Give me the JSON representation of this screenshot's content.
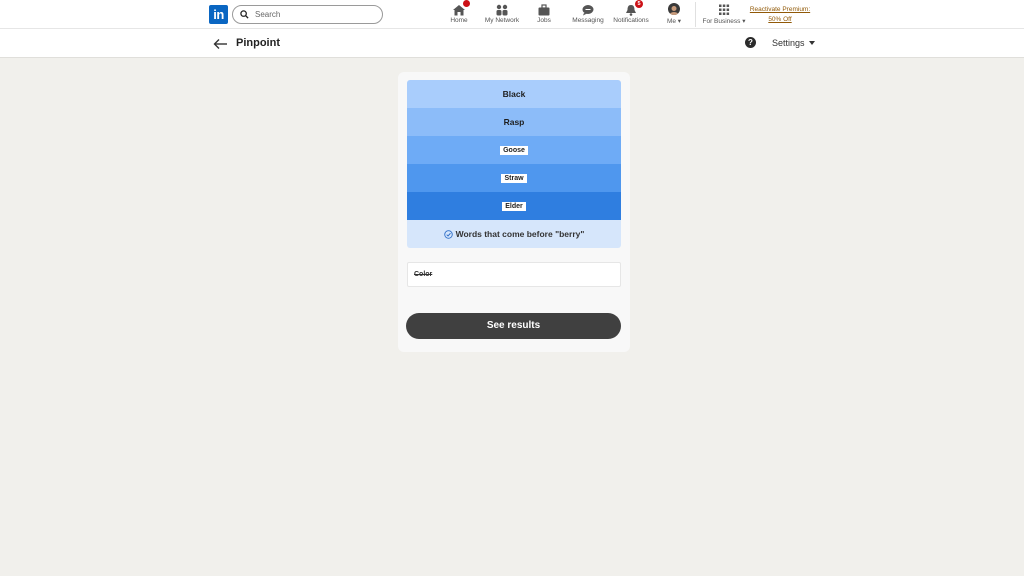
{
  "topnav": {
    "logo_text": "in",
    "search_placeholder": "Search",
    "items": [
      {
        "label": "Home",
        "icon": "home-icon",
        "badge": ""
      },
      {
        "label": "My Network",
        "icon": "network-icon",
        "badge": ""
      },
      {
        "label": "Jobs",
        "icon": "briefcase-icon",
        "badge": ""
      },
      {
        "label": "Messaging",
        "icon": "messaging-icon",
        "badge": ""
      },
      {
        "label": "Notifications",
        "icon": "bell-icon",
        "badge": "5"
      },
      {
        "label": "Me",
        "icon": "avatar",
        "badge": ""
      },
      {
        "label": "For Business",
        "icon": "grid-icon",
        "badge": ""
      }
    ],
    "premium_line1": "Reactivate Premium:",
    "premium_line2": "50% Off"
  },
  "subheader": {
    "title": "Pinpoint",
    "settings_label": "Settings"
  },
  "game": {
    "clues": [
      {
        "text": "Black",
        "revealed": true,
        "color": "#a9cdfc"
      },
      {
        "text": "Rasp",
        "revealed": true,
        "color": "#8cbcf9"
      },
      {
        "text": "Goose",
        "revealed": false,
        "color": "#6eabf6"
      },
      {
        "text": "Straw",
        "revealed": false,
        "color": "#4f97ee"
      },
      {
        "text": "Elder",
        "revealed": false,
        "color": "#2f7ee0"
      }
    ],
    "answer": "Words that come before \"berry\"",
    "answer_color": "#d6e6fb",
    "wrong_guess": "Color",
    "results_button": "See results"
  }
}
